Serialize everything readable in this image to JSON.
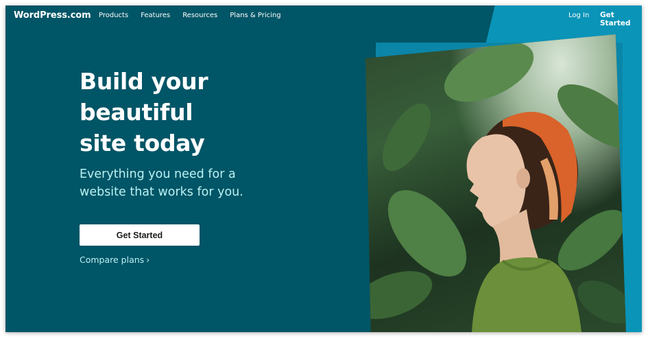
{
  "header": {
    "logo": "WordPress.com",
    "nav": [
      "Products",
      "Features",
      "Resources",
      "Plans & Pricing"
    ],
    "login": "Log In",
    "get_started": "Get Started"
  },
  "hero": {
    "headline_lines": [
      "Build your",
      "beautiful",
      "site today"
    ],
    "subline_lines": [
      "Everything you need for a",
      "website that works for you."
    ],
    "cta": "Get Started",
    "compare": "Compare plans",
    "compare_chevron": "›"
  },
  "colors": {
    "background": "#005566",
    "accent": "#0a94b8",
    "subtext": "#b9f2f5"
  },
  "icons": [
    "chevron-right-icon"
  ]
}
